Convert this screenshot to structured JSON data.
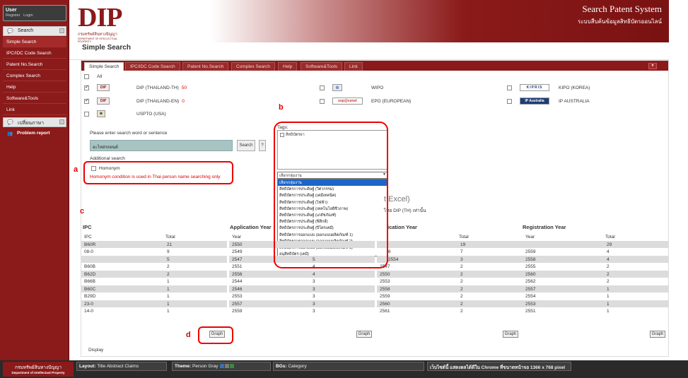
{
  "sidebar": {
    "user": {
      "label": "User",
      "register": "Register",
      "login": "Login"
    },
    "search_section": "Search",
    "items": [
      "Simple Search",
      "IPC/IDC Code Search",
      "Patent No.Search",
      "Complex Search",
      "Help",
      "Software&Tools",
      "Link"
    ],
    "language_section": "เปลี่ยนภาษา",
    "problem_report": "Problem report"
  },
  "header": {
    "logo_text": "DIP",
    "logo_th": "กรมทรัพย์สินทางปัญญา",
    "logo_en": "DEPARTMENT OF INTELLECTUAL PROPERTY",
    "system_title": "Search Patent System",
    "system_subtitle": "ระบบสืบค้นข้อมูลสิทธิบัตรออนไลน์",
    "page_title": "Simple Search"
  },
  "tabs": [
    "Simple Search",
    "IPC/IDC Code Search",
    "Patent No.Search",
    "Complex Search",
    "Help",
    "Software&Tools",
    "Link"
  ],
  "sources": {
    "all_label": "All",
    "items": [
      {
        "name": "DIP (THAILAND-TH)",
        "count": "50",
        "logo": "DIP",
        "checked": true
      },
      {
        "name": "DIP (THAILAND-EN)",
        "count": "0",
        "logo": "DIP",
        "checked": true
      },
      {
        "name": "USPTO (USA)",
        "count": "",
        "logo": "",
        "checked": false
      },
      {
        "name": "WIPO",
        "count": "",
        "logo": "",
        "checked": false
      },
      {
        "name": "EPO (EUROPEAN)",
        "count": "",
        "logo": "esp@cenet",
        "checked": false
      },
      {
        "name": "KIPO (KOREA)",
        "count": "",
        "logo": "KIPRIS",
        "checked": false
      },
      {
        "name": "IP AUSTRALIA",
        "count": "",
        "logo": "IP Australia",
        "checked": false
      }
    ]
  },
  "search": {
    "prompt": "Please enter search word or sentence",
    "value": "อะไหล่รถยนต์",
    "button": "Search",
    "help": "?",
    "additional": "Additional search",
    "homonym": "Homonym",
    "homonym_note": "Homonym condition is used in Thai person name searching only"
  },
  "tags": {
    "label": "Tags:",
    "checkbox_label": "สิทธิบัตรยา",
    "selected": "เลือกกลุ่มงาน",
    "options": [
      "เลือกกลุ่มงาน",
      "สิทธิบัตรการประดิษฐ์ (วิศวกรรม)",
      "สิทธิบัตรการประดิษฐ์ (เคมีเทคนิค)",
      "สิทธิบัตรการประดิษฐ์ (ไฟฟ้า)",
      "สิทธิบัตรการประดิษฐ์ (เทคโนโลยีชีวภาพ)",
      "สิทธิบัตรการประดิษฐ์ (เภสัชภัณฑ์)",
      "สิทธิบัตรการประดิษฐ์ (ฟิสิกส์)",
      "สิทธิบัตรการประดิษฐ์ (ปิโตรเคมี)",
      "สิทธิบัตรการออกแบบ (ออกแบบผลิตภัณฑ์ 1)",
      "สิทธิบัตรการออกแบบ (ออกแบบผลิตภัณฑ์ 2)",
      "สิทธิบัตรการออกแบบ (ออกแบบผลิตภัณฑ์ 3)",
      "อนุสิทธิบัตร (เคมี)",
      "อนุสิทธิบัตร (วิศวกรรม)"
    ]
  },
  "results": {
    "title_fragment": "t Excel)",
    "subtitle_fragment": "ไทย DIP (TH) เท่านั้น",
    "columns": [
      {
        "title": "IPC",
        "h1": "IPC",
        "h2": "Total",
        "rows": [
          [
            "B60R",
            "21"
          ],
          [
            "08-0",
            "9"
          ],
          [
            "",
            "5"
          ],
          [
            "B60B",
            "2"
          ],
          [
            "B62D",
            "2"
          ],
          [
            "B66B",
            "1"
          ],
          [
            "B60C",
            "1"
          ],
          [
            "B29D",
            "1"
          ],
          [
            "23-0",
            "1"
          ],
          [
            "14-0",
            "1"
          ]
        ]
      },
      {
        "title": "Application Year",
        "h1": "Year",
        "h2": "",
        "rows": [
          [
            "2550",
            ""
          ],
          [
            "2549",
            ""
          ],
          [
            "2547",
            "5"
          ],
          [
            "2551",
            "4"
          ],
          [
            "2556",
            "4"
          ],
          [
            "2544",
            "3"
          ],
          [
            "2546",
            "3"
          ],
          [
            "2553",
            "3"
          ],
          [
            "2557",
            "3"
          ],
          [
            "2559",
            "3"
          ]
        ]
      },
      {
        "title": "ication Year",
        "h1": "",
        "h2": "Total",
        "rows": [
          [
            "",
            "19"
          ],
          [
            "6",
            "7"
          ],
          [
            "2554",
            "3"
          ],
          [
            "2547",
            "2"
          ],
          [
            "2550",
            "2"
          ],
          [
            "2553",
            "2"
          ],
          [
            "2558",
            "2"
          ],
          [
            "2559",
            "2"
          ],
          [
            "2560",
            "2"
          ],
          [
            "2561",
            "2"
          ]
        ]
      },
      {
        "title": "Registration Year",
        "h1": "Year",
        "h2": "Total",
        "rows": [
          [
            "",
            "29"
          ],
          [
            "2559",
            "4"
          ],
          [
            "2558",
            "4"
          ],
          [
            "2555",
            "2"
          ],
          [
            "2560",
            "2"
          ],
          [
            "2562",
            "2"
          ],
          [
            "2557",
            "1"
          ],
          [
            "2554",
            "1"
          ],
          [
            "2553",
            "1"
          ],
          [
            "2551",
            "1"
          ]
        ]
      }
    ],
    "graph_label": "Graph"
  },
  "display": {
    "label": "Display",
    "select_all": "Select All"
  },
  "annotations": {
    "a": "a",
    "b": "b",
    "c": "c",
    "d": "d"
  },
  "bottombar": {
    "logo_th": "กรมทรัพย์สินทางปัญญา",
    "logo_en": "Department of Intellectual Property",
    "layout_label": "Layout:",
    "layout_options": [
      "Title",
      "Abstract",
      "Claims"
    ],
    "theme_label": "Theme:",
    "theme_options": [
      "Person",
      "Gray"
    ],
    "bg_label": "BGs:",
    "bg_option": "Category",
    "notice": "เว็บไซต์นี้ แสดงผลได้ดีใน Chrome ที่ขนาดหน้าจอ 1366 x 768 pixel"
  },
  "colors": {
    "brand": "#8b1a1a",
    "select_highlight": "#1e64c8",
    "annotation": "#e00000"
  }
}
